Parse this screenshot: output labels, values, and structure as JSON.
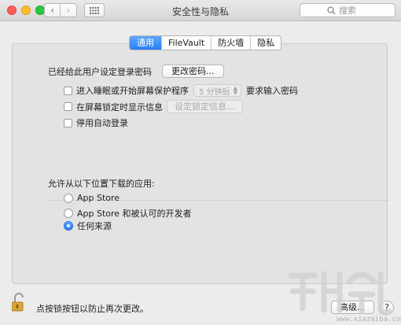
{
  "window": {
    "title": "安全性与隐私"
  },
  "toolbar": {
    "back_glyph": "‹",
    "forward_glyph": "›",
    "grid_icon": "grid-icon",
    "search_placeholder": "搜索"
  },
  "tabs": [
    {
      "label": "通用",
      "active": true
    },
    {
      "label": "FileVault",
      "active": false
    },
    {
      "label": "防火墙",
      "active": false
    },
    {
      "label": "隐私",
      "active": false
    }
  ],
  "general": {
    "password_label": "已经给此用户设定登录密码",
    "change_password_button": "更改密码...",
    "sleep_checkbox_label": "进入睡眠或开始屏幕保护程序",
    "sleep_delay_value": "5 分钟后",
    "require_password_label": "要求输入密码",
    "lock_message_checkbox_label": "在屏幕锁定时显示信息",
    "set_lock_message_button": "设定锁定信息...",
    "disable_autologin_label": "停用自动登录"
  },
  "downloads": {
    "heading": "允许从以下位置下载的应用:",
    "options": [
      {
        "label": "App Store",
        "selected": false
      },
      {
        "label": "App Store 和被认可的开发者",
        "selected": false
      },
      {
        "label": "任何来源",
        "selected": true
      }
    ]
  },
  "footer": {
    "lock_text": "点按锁按钮以防止再次更改。",
    "advanced_button": "高级...",
    "help_glyph": "?"
  },
  "watermark": {
    "text": "www.xiazaiba.com"
  },
  "colors": {
    "accent": "#2a7ef4",
    "close": "#fc5f57",
    "minimize": "#fdbc2e",
    "zoom": "#28c840"
  }
}
